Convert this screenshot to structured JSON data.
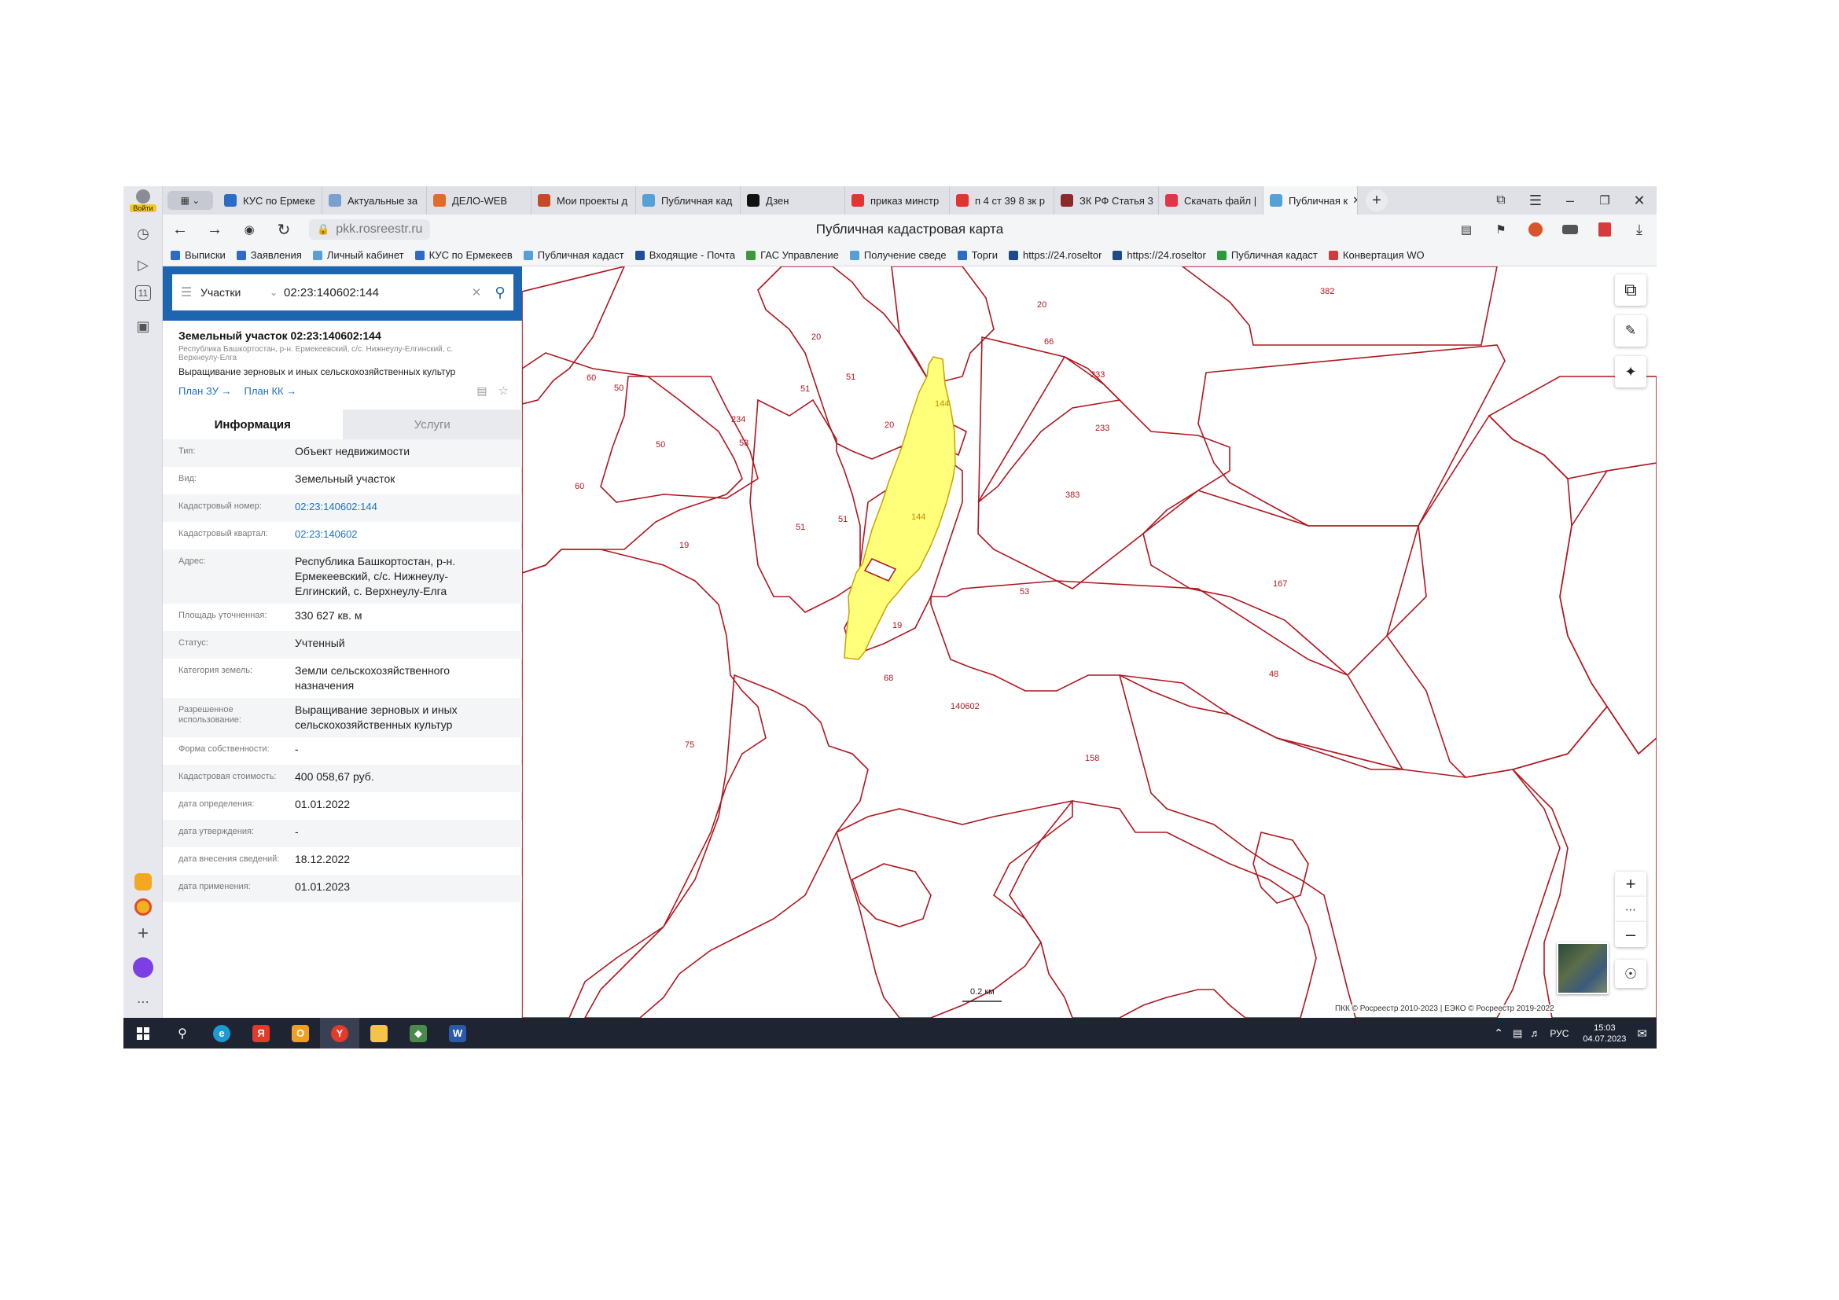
{
  "yandex_sidebar": {
    "login_label": "Войти",
    "badge": "11"
  },
  "tabs": [
    {
      "label": "КУС по Ермеке",
      "icon_color": "#2b6cc4"
    },
    {
      "label": "Актуальные за",
      "icon_color": "#7aa0d0"
    },
    {
      "label": "ДЕЛО-WEB",
      "icon_color": "#e46a2c"
    },
    {
      "label": "Мои проекты д",
      "icon_color": "#c74a28"
    },
    {
      "label": "Публичная кад",
      "icon_color": "#56a0d8"
    },
    {
      "label": "Дзен",
      "icon_color": "#111111"
    },
    {
      "label": "приказ минстр",
      "icon_color": "#e43333"
    },
    {
      "label": "п 4 ст 39 8 зк р",
      "icon_color": "#e43333"
    },
    {
      "label": "ЗК РФ Статья 3",
      "icon_color": "#8a2a2a"
    },
    {
      "label": "Скачать файл |",
      "icon_color": "#e4334a"
    },
    {
      "label": "Публичная к",
      "icon_color": "#56a0d8",
      "active": true
    }
  ],
  "address": {
    "url": "pkk.rosreestr.ru",
    "page_title": "Публичная кадастровая карта"
  },
  "bookmarks": [
    {
      "label": "Выписки",
      "color": "#2b6cc4"
    },
    {
      "label": "Заявления",
      "color": "#2b6cc4"
    },
    {
      "label": "Личный кабинет",
      "color": "#56a0d8"
    },
    {
      "label": "КУС по Ермекеев",
      "color": "#2b6cc4"
    },
    {
      "label": "Публичная кадаст",
      "color": "#56a0d8"
    },
    {
      "label": "Входящие - Почта",
      "color": "#1f4f9a"
    },
    {
      "label": "ГАС Управление",
      "color": "#3a9a3a"
    },
    {
      "label": "Получение сведе",
      "color": "#56a0d8"
    },
    {
      "label": "Торги",
      "color": "#2b6cc4"
    },
    {
      "label": "https://24.roseltor",
      "color": "#1d4a8a"
    },
    {
      "label": "https://24.roseltor",
      "color": "#1d4a8a"
    },
    {
      "label": "Публичная кадаст",
      "color": "#2a9a3a"
    },
    {
      "label": "Конвертация WO",
      "color": "#d43a3a"
    }
  ],
  "search": {
    "type_label": "Участки",
    "query": "02:23:140602:144"
  },
  "card": {
    "title": "Земельный участок 02:23:140602:144",
    "address_small": "Республика Башкортостан, р-н. Ермекеевский, с/с. Нижнеулу-Елгинский, с. Верхнеулу-Елга",
    "use": "Выращивание зерновых и иных сельскохозяйственных культур",
    "plan_zu": "План ЗУ →",
    "plan_kk": "План КК →",
    "tab_info": "Информация",
    "tab_services": "Услуги"
  },
  "rows": [
    {
      "key": "Тип:",
      "value": "Объект недвижимости"
    },
    {
      "key": "Вид:",
      "value": "Земельный участок"
    },
    {
      "key": "Кадастровый номер:",
      "value": "02:23:140602:144",
      "link": true
    },
    {
      "key": "Кадастровый квартал:",
      "value": "02:23:140602",
      "link": true
    },
    {
      "key": "Адрес:",
      "value": "Республика Башкортостан, р-н. Ермекеевский, с/с. Нижнеулу-Елгинский, с. Верхнеулу-Елга"
    },
    {
      "key": "Площадь уточненная:",
      "value": "330 627 кв. м"
    },
    {
      "key": "Статус:",
      "value": "Учтенный"
    },
    {
      "key": "Категория земель:",
      "value": "Земли сельскохозяйственного назначения"
    },
    {
      "key": "Разрешенное использование:",
      "value": "Выращивание зерновых и иных сельскохозяйственных культур"
    },
    {
      "key": "Форма собственности:",
      "value": "-"
    },
    {
      "key": "Кадастровая стоимость:",
      "value": "400 058,67 руб."
    },
    {
      "key": "дата определения:",
      "value": "01.01.2022"
    },
    {
      "key": "дата утверждения:",
      "value": "-"
    },
    {
      "key": "дата внесения сведений:",
      "value": "18.12.2022"
    },
    {
      "key": "дата применения:",
      "value": "01.01.2023"
    }
  ],
  "map": {
    "line_color": "#b0171f",
    "parcel_fill": "#ffff7a",
    "labels": [
      "20",
      "382",
      "20",
      "66",
      "60",
      "50",
      "51",
      "51",
      "233",
      "144",
      "234",
      "20",
      "233",
      "50",
      "58",
      "60",
      "383",
      "144",
      "51",
      "51",
      "19",
      "53",
      "167",
      "19",
      "68",
      "140602",
      "75",
      "158",
      "48"
    ],
    "scale": "0.2 км",
    "copyright": "ПКК © Росреестр 2010-2023 | ЕЭКО © Росреестр 2019-2022"
  },
  "taskbar": {
    "lang": "РУС",
    "time": "15:03",
    "date": "04.07.2023"
  }
}
